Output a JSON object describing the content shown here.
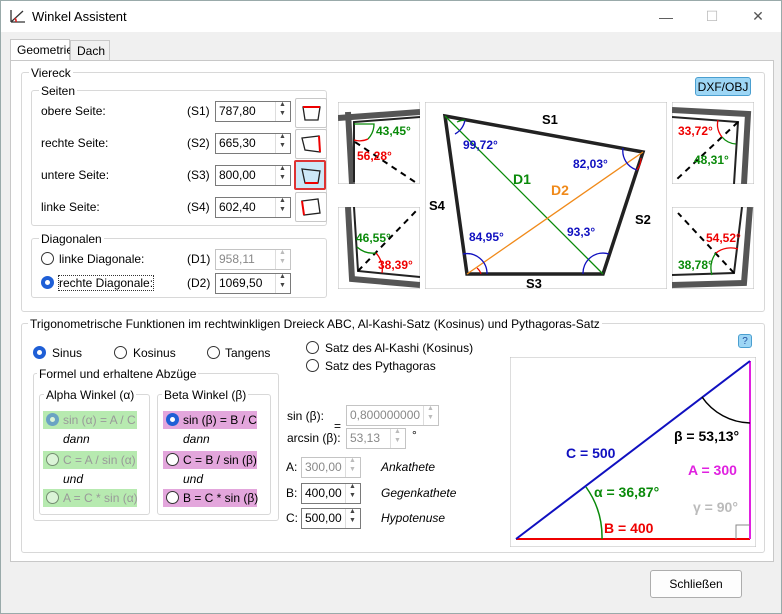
{
  "window": {
    "title": "Winkel Assistent",
    "minimize": "—",
    "maximize": "☐",
    "close": "✕"
  },
  "tabs": [
    "Geometrie",
    "Dach"
  ],
  "viereck": {
    "group_label": "Viereck",
    "dxf_button": "DXF/OBJ",
    "seiten_label": "Seiten",
    "sides": [
      {
        "label": "obere Seite:",
        "code": "(S1)",
        "value": "787,80"
      },
      {
        "label": "rechte Seite:",
        "code": "(S2)",
        "value": "665,30"
      },
      {
        "label": "untere Seite:",
        "code": "(S3)",
        "value": "800,00"
      },
      {
        "label": "linke Seite:",
        "code": "(S4)",
        "value": "602,40"
      }
    ],
    "diagonalen_label": "Diagonalen",
    "diagonals": [
      {
        "label": "linke Diagonale:",
        "code": "(D1)",
        "value": "958,11"
      },
      {
        "label": "rechte Diagonale:",
        "code": "(D2)",
        "value": "1069,50"
      }
    ],
    "diagram": {
      "S1": "S1",
      "S2": "S2",
      "S3": "S3",
      "S4": "S4",
      "D1": "D1",
      "D2": "D2",
      "angle_tl": "99,72°",
      "angle_tr": "82,03°",
      "angle_bl": "84,95°",
      "angle_br": "93,3°",
      "tl_green": "43,45°",
      "tl_red": "56,28°",
      "tr_red": "33,72°",
      "tr_green": "48,31°",
      "bl_green": "46,55°",
      "bl_red": "38,39°",
      "br_red": "54,52°",
      "br_green": "38,78°"
    }
  },
  "trig": {
    "group_label": "Trigonometrische Funktionen im rechtwinkligen Dreieck ABC, Al-Kashi-Satz (Kosinus) und Pythagoras-Satz",
    "functions": [
      "Sinus",
      "Kosinus",
      "Tangens"
    ],
    "theorems": [
      "Satz des Al-Kashi (Kosinus)",
      "Satz des Pythagoras"
    ],
    "help": "?",
    "formula_group": "Formel und erhaltene Abzüge",
    "alpha_group": "Alpha Winkel (α)",
    "beta_group": "Beta Winkel (β)",
    "alpha": [
      "sin (α) = A / C",
      "C = A / sin (α)",
      "A = C * sin (α)"
    ],
    "beta": [
      "sin (β) = B / C",
      "C = B / sin (β)",
      "B = C * sin (β)"
    ],
    "dann": "dann",
    "und": "und",
    "sin_label": "sin (β):",
    "arcsin_label": "arcsin (β):",
    "equals": "=",
    "degree": "°",
    "sin_value": "0,800000000",
    "arcsin_value": "53,13",
    "A_label": "A:",
    "A_value": "300,00",
    "A_desc": "Ankathete",
    "B_label": "B:",
    "B_value": "400,00",
    "B_desc": "Gegenkathete",
    "C_label": "C:",
    "C_value": "500,00",
    "C_desc": "Hypotenuse",
    "triangle": {
      "C": "C = 500",
      "beta": "β = 53,13°",
      "A": "A = 300",
      "alpha": "α = 36,87°",
      "gamma": "γ = 90°",
      "B": "B = 400"
    }
  },
  "footer": {
    "close_button": "Schließen"
  },
  "colors": {
    "green": "#0a8a0a",
    "red": "#e00000",
    "blue": "#1010c0",
    "orange": "#f08a1a",
    "magenta": "#e020e0"
  }
}
